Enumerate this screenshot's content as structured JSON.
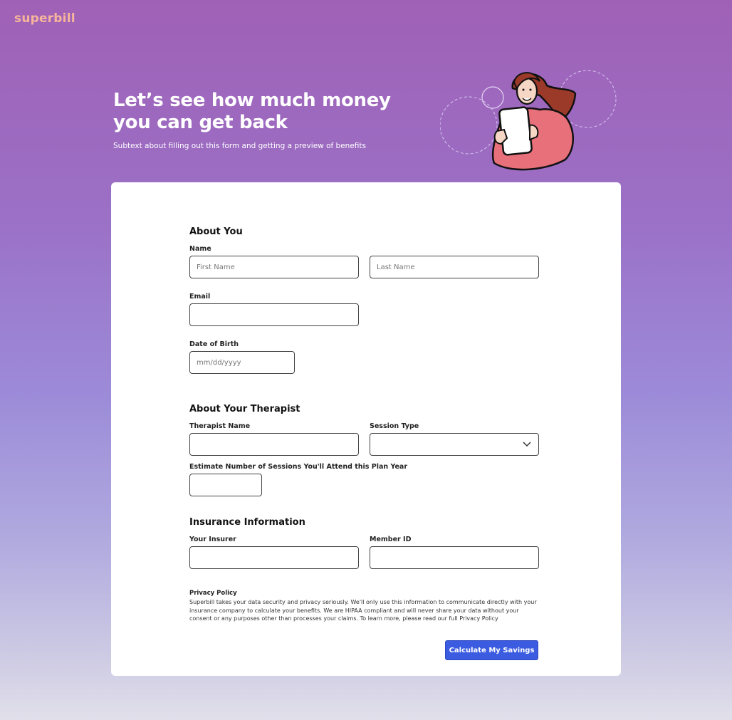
{
  "brand": {
    "logo_text": "superbill"
  },
  "hero": {
    "title": "Let’s see how much money you can get back",
    "subtitle": "Subtext about filling out this form and getting a preview of benefits"
  },
  "about_you": {
    "title": "About You",
    "name_label": "Name",
    "first_name_placeholder": "First Name",
    "last_name_placeholder": "Last Name",
    "email_label": "Email",
    "dob_label": "Date of Birth",
    "dob_placeholder": "mm/dd/yyyy"
  },
  "therapist": {
    "title": "About Your Therapist",
    "name_label": "Therapist Name",
    "session_type_label": "Session Type",
    "sessions_label": "Estimate Number of Sessions You'll Attend this Plan Year"
  },
  "insurance": {
    "title": "Insurance Information",
    "insurer_label": "Your Insurer",
    "member_id_label": "Member ID"
  },
  "privacy": {
    "title": "Privacy Policy",
    "text": "Superbill takes your data security and privacy seriously. We'll only use this information to communicate directly with your insurance company to calculate your benefits. We are HIPAA compliant and will never share your data without your consent or any purposes other than processes your claims. To learn more, please read our full Privacy Policy"
  },
  "submit": {
    "label": "Calculate My Savings"
  },
  "colors": {
    "accent": "#3b5be0",
    "logo": "#f6b59b",
    "illustration_jacket": "#e8707a"
  },
  "icons": {
    "dropdown": "chevron-down-icon",
    "illustration": "woman-with-tablet-illustration"
  }
}
